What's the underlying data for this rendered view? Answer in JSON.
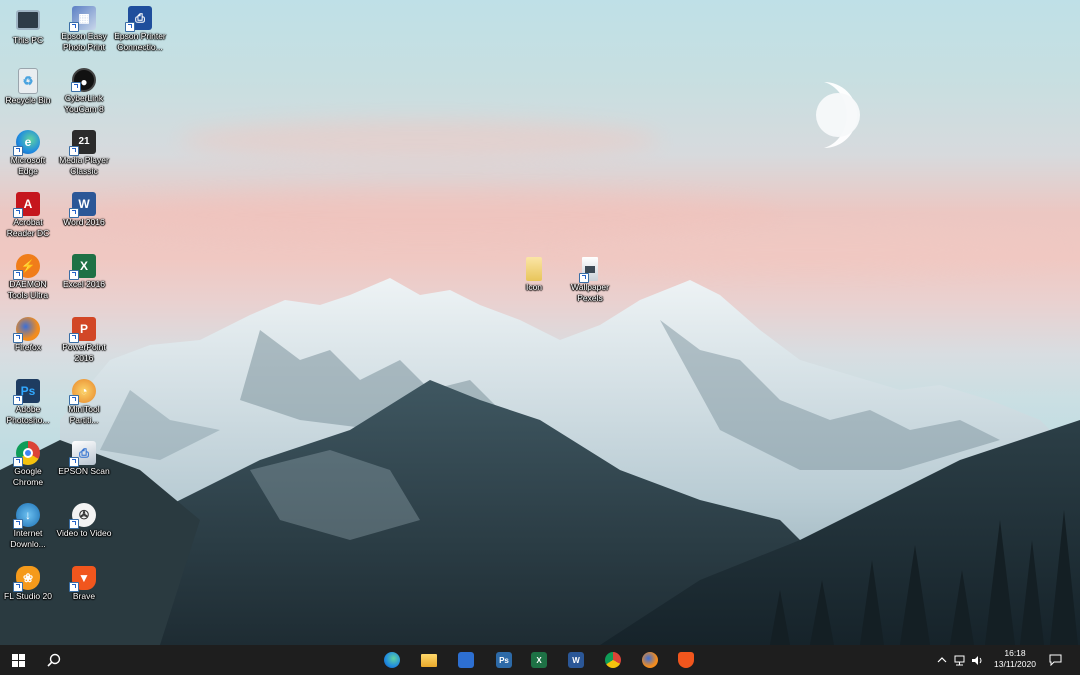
{
  "desktop": {
    "icons": [
      {
        "label": "This PC",
        "icon": "computer-icon"
      },
      {
        "label": "Recycle Bin",
        "icon": "recycle-bin-icon"
      },
      {
        "label": "Microsoft Edge",
        "icon": "edge-icon"
      },
      {
        "label": "Acrobat Reader DC",
        "icon": "acrobat-icon"
      },
      {
        "label": "DAEMON Tools Ultra",
        "icon": "daemon-tools-icon"
      },
      {
        "label": "Firefox",
        "icon": "firefox-icon"
      },
      {
        "label": "Adobe Photosho...",
        "icon": "photoshop-icon"
      },
      {
        "label": "Google Chrome",
        "icon": "chrome-icon"
      },
      {
        "label": "Internet Downlo...",
        "icon": "internet-download-manager-icon"
      },
      {
        "label": "FL Studio 20",
        "icon": "fl-studio-icon"
      },
      {
        "label": "Epson Easy Photo Print",
        "icon": "epson-photo-print-icon"
      },
      {
        "label": "CyberLink YouCam 8",
        "icon": "youcam-icon"
      },
      {
        "label": "Media Player Classic",
        "icon": "media-player-classic-icon"
      },
      {
        "label": "Word 2016",
        "icon": "word-icon"
      },
      {
        "label": "Excel 2016",
        "icon": "excel-icon"
      },
      {
        "label": "PowerPoint 2016",
        "icon": "powerpoint-icon"
      },
      {
        "label": "MiniTool Partiti...",
        "icon": "minitool-icon"
      },
      {
        "label": "EPSON Scan",
        "icon": "epson-scan-icon"
      },
      {
        "label": "Video to Video",
        "icon": "video-to-video-icon"
      },
      {
        "label": "Brave",
        "icon": "brave-icon"
      },
      {
        "label": "Epson Printer Connectio...",
        "icon": "epson-printer-icon"
      },
      {
        "label": "Icon",
        "icon": "folder-icon"
      },
      {
        "label": "Wallpaper Pexels",
        "icon": "wallpaper-file-icon"
      }
    ]
  },
  "taskbar": {
    "start": "windows-icon",
    "search": "search-icon",
    "pinned": [
      {
        "name": "Microsoft Edge",
        "icon": "edge-icon",
        "color": "#1f8ae0"
      },
      {
        "name": "File Explorer",
        "icon": "folder-icon",
        "color": "#f3b53a"
      },
      {
        "name": "Epson Scan",
        "icon": "scanner-icon",
        "color": "#2d6fd1"
      },
      {
        "name": "Photoshop",
        "icon": "photoshop-icon",
        "color": "#2d6aa8",
        "text": "Ps"
      },
      {
        "name": "Excel",
        "icon": "excel-icon",
        "color": "#1e7145",
        "text": "X"
      },
      {
        "name": "Word",
        "icon": "word-icon",
        "color": "#2b5797",
        "text": "W"
      },
      {
        "name": "Chrome",
        "icon": "chrome-icon",
        "color": "#e0a12d"
      },
      {
        "name": "Firefox",
        "icon": "firefox-icon",
        "color": "#f28c1e"
      },
      {
        "name": "Brave",
        "icon": "brave-icon",
        "color": "#f1561d"
      }
    ],
    "tray": {
      "time": "16:18",
      "date": "13/11/2020"
    }
  },
  "colors": {
    "taskbar": "#1e1e1e",
    "sky_top": "#bfe0e7",
    "sky_pink": "#f0c8c2"
  }
}
